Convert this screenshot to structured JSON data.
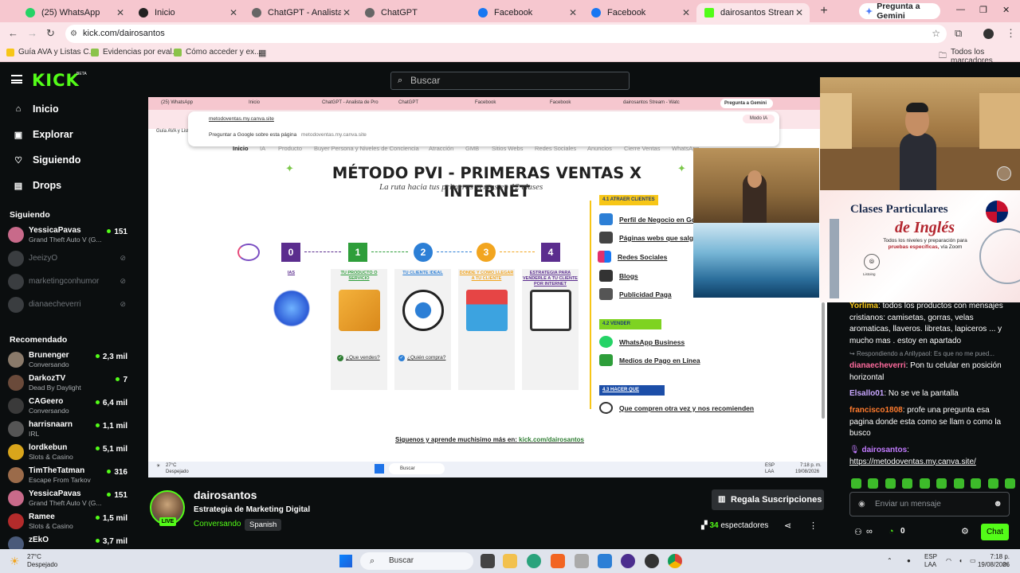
{
  "browser": {
    "tabs": [
      {
        "label": "(25) WhatsApp",
        "color": "#25d366"
      },
      {
        "label": "Inicio",
        "color": "#222222"
      },
      {
        "label": "ChatGPT - Analista de Pro",
        "color": "#555555"
      },
      {
        "label": "ChatGPT",
        "color": "#555555"
      },
      {
        "label": "Facebook",
        "color": "#1877f2"
      },
      {
        "label": "Facebook",
        "color": "#1877f2"
      },
      {
        "label": "dairosantos Stream - Watc",
        "color": "#53fc18"
      }
    ],
    "gemini_label": "Pregunta a Gemini",
    "url": "kick.com/dairosantos",
    "bookmarks": [
      "Guía AVA y Listas C...",
      "Evidencias por eval...",
      "Cómo acceder y ex..."
    ],
    "all_bookmarks": "Todos los marcadores"
  },
  "kick": {
    "logo": "KICK",
    "beta": "BETA",
    "search_placeholder": "Buscar",
    "nav": [
      {
        "label": "Inicio",
        "icon": "home-icon"
      },
      {
        "label": "Explorar",
        "icon": "compass-icon"
      },
      {
        "label": "Siguiendo",
        "icon": "heart-icon"
      },
      {
        "label": "Drops",
        "icon": "drop-icon"
      }
    ],
    "following_title": "Siguiendo",
    "following": [
      {
        "name": "YessicaPavas",
        "game": "Grand Theft Auto V (G...",
        "count": "151",
        "live": true
      },
      {
        "name": "JeeizyO",
        "live": false
      },
      {
        "name": "marketingconhumor",
        "live": false
      },
      {
        "name": "dianaecheverri",
        "live": false
      }
    ],
    "recommended_title": "Recomendado",
    "recommended": [
      {
        "name": "Brunenger",
        "game": "Conversando",
        "count": "2,3 mil"
      },
      {
        "name": "DarkozTV",
        "game": "Dead By Daylight",
        "count": "7"
      },
      {
        "name": "CAGeero",
        "game": "Conversando",
        "count": "6,4 mil"
      },
      {
        "name": "harrisnaarn",
        "game": "IRL",
        "count": "1,1 mil"
      },
      {
        "name": "lordkebun",
        "game": "Slots & Casino",
        "count": "5,1 mil"
      },
      {
        "name": "TimTheTatman",
        "game": "Escape From Tarkov",
        "count": "316"
      },
      {
        "name": "YessicaPavas",
        "game": "Grand Theft Auto V (G...",
        "count": "151"
      },
      {
        "name": "Ramee",
        "game": "Slots & Casino",
        "count": "1,5 mil"
      },
      {
        "name": "zEkO",
        "game": "",
        "count": "3,7 mil"
      }
    ]
  },
  "video": {
    "inner_tabs": [
      "(25) WhatsApp",
      "Inicio",
      "ChatGPT - Analista de Pro",
      "ChatGPT",
      "Facebook",
      "Facebook",
      "dairosantos Stream - Watc"
    ],
    "inner_gemini": "Pregunta a Gemini",
    "inner_url": "metodoventas.my.canva.site",
    "inner_ask": "Preguntar a Google sobre esta página",
    "inner_site": "metodoventas.my.canva.site",
    "inner_modo": "Modo IA",
    "inner_bm": "Guía AVA y Listas C...",
    "site_nav": [
      "Inicio",
      "IA",
      "Producto",
      "Buyer Persona y Niveles de Conciencia",
      "Atracción",
      "GMB",
      "Sitios Webs",
      "Redes Sociales",
      "Anuncios",
      "Cierre Ventas",
      "WhatsApp"
    ],
    "title": "MÉTODO PVI - PRIMERAS VENTAS X INTERNET",
    "subtitle": "La ruta hacia tus primeras ventas en 12 clases",
    "steps": [
      {
        "num": "0",
        "label": "IAS",
        "color": "#5b2d8e"
      },
      {
        "num": "1",
        "label": "TU PRODUCTO O SERVICIO",
        "color": "#2e9e3a"
      },
      {
        "num": "2",
        "label": "TU CLIENTE IDEAL",
        "color": "#2c7fd6"
      },
      {
        "num": "3",
        "label": "DONDE Y COMO LLEGAR A TU CLIENTE",
        "color": "#f2a51f"
      },
      {
        "num": "4",
        "label": "ESTRATEGIA PARA VENDERLE A TU CLIENTE POR INTERNET",
        "color": "#5b2d8e"
      }
    ],
    "q1": "¿Que vendes?",
    "q2": "¿Quién compra?",
    "sections": [
      {
        "label": "4.1 ATRAER CLIENTES",
        "bg": "#f7c617",
        "fg": "#1c3a7a"
      },
      {
        "label": "4.2 VENDER",
        "bg": "#7ed321",
        "fg": "#1c3a7a"
      },
      {
        "label": "4.3 HACER QUE VUELVAN",
        "bg": "#1c4ea8",
        "fg": "#ffffff"
      }
    ],
    "attract_items": [
      "Perfil de Negocio en Goo",
      "Páginas webs que salgan",
      "Redes Sociales",
      "Blogs",
      "Publicidad Paga"
    ],
    "sell_items": [
      "WhatsApp Business",
      "Medios de Pago en Línea"
    ],
    "return_item": "Que compren otra vez y nos recomienden",
    "follow_text": "Siguenos y aprende muchisimo más en:",
    "follow_link": "kick.com/dairosantos",
    "inner_weather_temp": "27°C",
    "inner_weather_desc": "Despejado",
    "inner_search": "Buscar",
    "inner_lang": "ESP",
    "inner_lang2": "LAA",
    "inner_time": "7:18 p. m.",
    "inner_date": "19/08/2026"
  },
  "ad": {
    "title": "Clases Particulares",
    "title2": "de Inglés",
    "text_1": "Todos los niveles y preparación para",
    "text_2": "pruebas específicas,",
    "text_3": " vía Zoom",
    "logo_text": "Listoing"
  },
  "chat": {
    "messages": [
      {
        "user": "Yorlima",
        "color": "#f7c617",
        "text": ": todos los productos con mensajes cristianos: camisetas, gorras, velas aromaticas, llaveros. libretas, lapiceros ... y mucho mas . estoy en apartado"
      },
      {
        "user": "dianaecheverri",
        "color": "#ff6b9e",
        "text": ": Pon tu celular en posición horizontal"
      },
      {
        "user": "Elsallo01",
        "color": "#c9a7ff",
        "text": ": No se ve la pantalla"
      },
      {
        "user": "francisco1808",
        "color": "#ff7b2e",
        "text": ": profe una pregunta esa pagina donde esta como se llam o como la busco"
      },
      {
        "user": "dairosantos",
        "color": "#c27bff",
        "text": ":"
      }
    ],
    "reply_hint": "Respondiendo a Anllypaol: Es que no me pued...",
    "link": "https://metodoventas.my.canva.site/",
    "input_placeholder": "Enviar un mensaje",
    "points": "0",
    "send_label": "Chat"
  },
  "streamer": {
    "name": "dairosantos",
    "title": "Estrategia de Marketing Digital",
    "category": "Conversando",
    "language": "Spanish",
    "live": "LIVE",
    "subs_label": "Regala Suscripciones",
    "viewers": "34",
    "viewers_label": "espectadores"
  },
  "taskbar": {
    "temp": "27°C",
    "weather": "Despejado",
    "search": "Buscar",
    "lang": "ESP",
    "lang2": "LAA",
    "time": "7:18 p. m.",
    "date": "19/08/2026"
  }
}
